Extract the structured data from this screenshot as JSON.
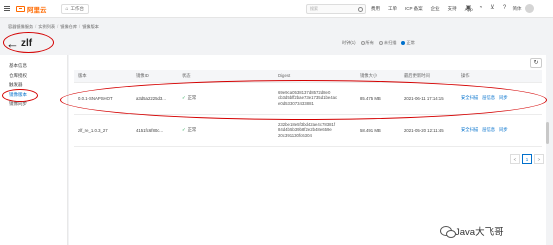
{
  "topbar": {
    "logo": "阿里云",
    "workspace": "工作台",
    "search_placeholder": "搜索",
    "nav": [
      "费用",
      "工单",
      "ICP 备案",
      "企业",
      "支持",
      "App"
    ],
    "icons": [
      "message-icon",
      "bell-icon",
      "cart-icon",
      "help-icon"
    ],
    "lang": "简体"
  },
  "breadcrumb": [
    "容器镜像服务",
    "实例列表",
    "镜像仓库",
    "镜像版本"
  ],
  "page": {
    "title": "zlf"
  },
  "sidebar": {
    "items": [
      {
        "label": "基本信息",
        "active": false
      },
      {
        "label": "仓库授权",
        "active": false
      },
      {
        "label": "触发器",
        "active": false
      },
      {
        "label": "镜像版本",
        "active": true
      },
      {
        "label": "镜像同步",
        "active": false
      }
    ]
  },
  "filters": {
    "label_a": "时钟(1)",
    "opt_all": "所有",
    "opt_b": "未扫描",
    "opt_c": "正常"
  },
  "table": {
    "headers": [
      "版本",
      "镜像ID",
      "状态",
      "Digest",
      "镜像大小",
      "最后更新时间",
      "操作"
    ],
    "rows": [
      {
        "version": "0.0.1-SNAPSHOT",
        "image_id": "a3d5a2225d3...",
        "status": "正常",
        "digest_lines": [
          "69e9ca0538137d8572d8e0",
          "cb3d5bff2bae73e1735d1be4ac",
          "e0d533073433881"
        ],
        "size": "85.475 MB",
        "updated": "2021-06-11 17:14:15",
        "actions": [
          "安全扫描",
          "层信息",
          "同步"
        ]
      },
      {
        "version": "zlf_re_1.0.3_27",
        "image_id": "4151fc6f80c...",
        "status": "正常",
        "digest_lines": [
          "232be18e5f3bd42ae4c78381f",
          "84d4b5b39b8f2e2b48e659e",
          "20c391130fc6304"
        ],
        "size": "58.491 MB",
        "updated": "2021-05-20 12:11:45",
        "actions": [
          "安全扫描",
          "层信息",
          "同步"
        ]
      }
    ]
  },
  "pagination": {
    "prev": "<",
    "current": "1",
    "next": ">"
  },
  "watermark": {
    "text": "Java大飞哥"
  },
  "colors": {
    "accent": "#0070cc",
    "brand": "#ff6a00",
    "ok": "#1aa34a",
    "annotation": "#d40000"
  }
}
